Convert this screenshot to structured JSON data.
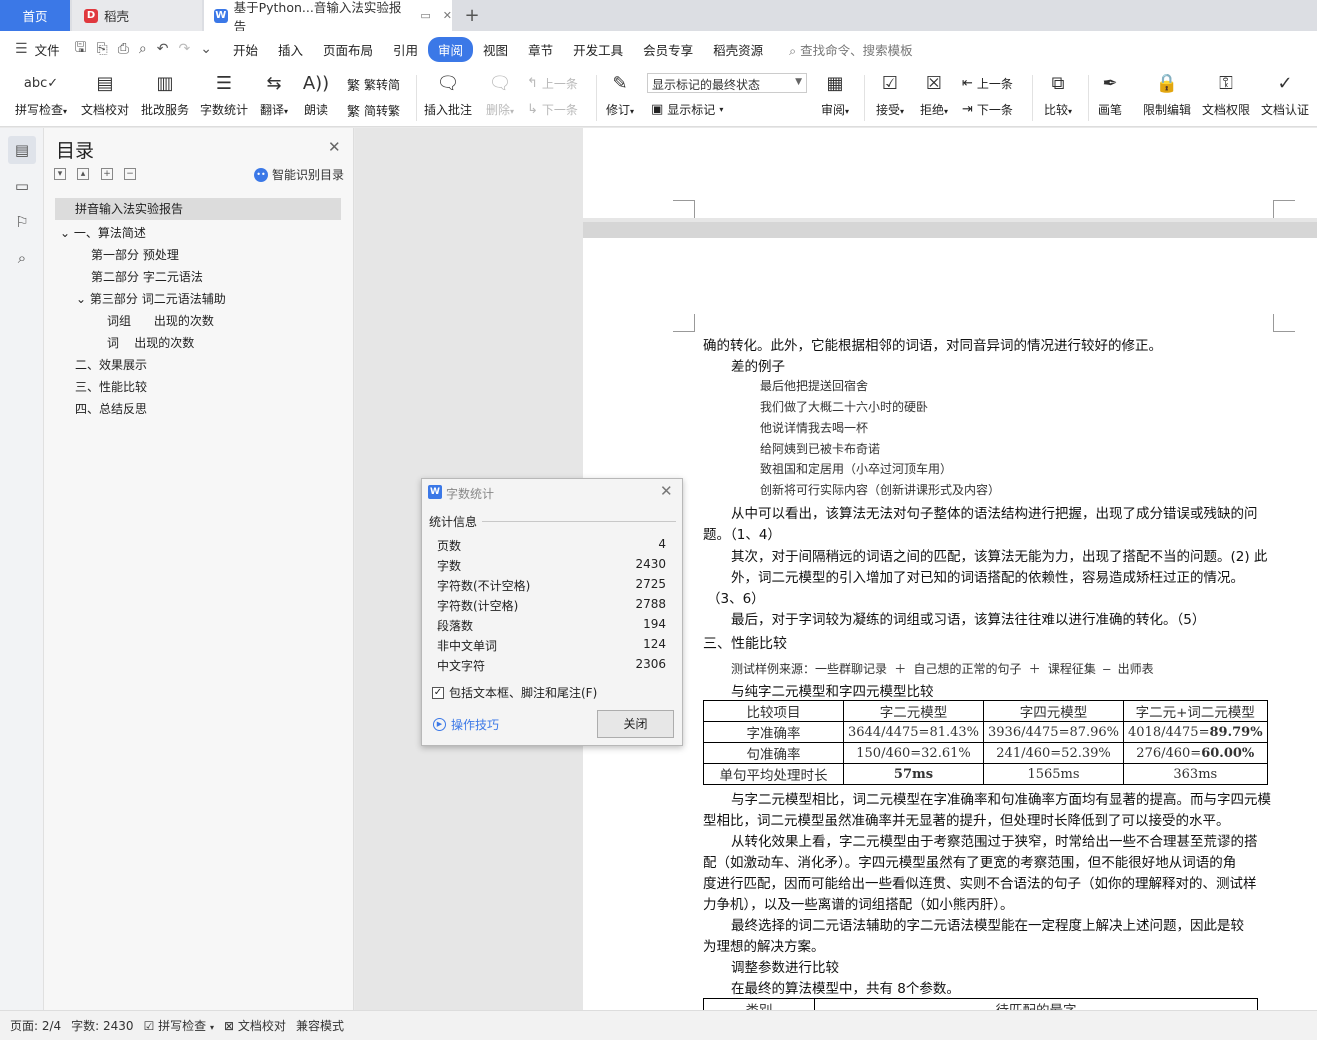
{
  "tabs": {
    "home": "首页",
    "daoke": "稻壳",
    "doc": "基于Python...音输入法实验报告",
    "plus": "+"
  },
  "menu": {
    "file": "文件",
    "items": [
      "开始",
      "插入",
      "页面布局",
      "引用",
      "审阅",
      "视图",
      "章节",
      "开发工具",
      "会员专享",
      "稻壳资源"
    ],
    "active": "审阅",
    "search": "查找命令、搜索模板"
  },
  "ribbon": {
    "spell": "拼写检查",
    "proofread": "文档校对",
    "review_service": "批改服务",
    "word_count": "字数统计",
    "translate": "翻译",
    "read_aloud": "朗读",
    "to_simplified": "繁转简",
    "to_traditional": "简转繁",
    "insert_comment": "插入批注",
    "delete": "删除",
    "prev": "上一条",
    "next": "下一条",
    "revise": "修订",
    "markup_state": "显示标记的最终状态",
    "show_markup": "显示标记",
    "review": "审阅",
    "accept": "接受",
    "reject": "拒绝",
    "prev2": "上一条",
    "next2": "下一条",
    "compare": "比较",
    "pen": "画笔",
    "restrict": "限制编辑",
    "permission": "文档权限",
    "certify": "文档认证"
  },
  "toc": {
    "title": "目录",
    "smart": "智能识别目录",
    "items": [
      "拼音输入法实验报告",
      "一、算法简述",
      "第一部分 预处理",
      "第二部分 字二元语法",
      "第三部分 词二元语法辅助",
      "词组      出现的次数",
      "词    出现的次数",
      "二、效果展示",
      "三、性能比较",
      "四、总结反思"
    ]
  },
  "doc": {
    "p1": "确的转化。此外，它能根据相邻的词语，对同音异词的情况进行较好的修正。",
    "bad_examples": "差的例子",
    "ex": [
      "最后他把提送回宿舍",
      "我们做了大概二十六小时的硬卧",
      "他说详情我去喝一杯",
      "给阿姨到已被卡布奇诺",
      "致祖国和定居用（小卒过河顶车用）",
      "创新将可行实际内容（创新讲课形式及内容）"
    ],
    "p2a": "从中可以看出，该算法无法对句子整体的语法结构进行把握，出现了成分错误或残缺的问",
    "p2b": "题。（1、4）",
    "p3a": "其次，对于间隔稍远的词语之间的匹配，该算法无能为力，出现了搭配不当的问题。(2)  此",
    "p3b": "外，词二元模型的引入增加了对已知的词语搭配的依赖性，容易造成矫枉过正的情况。",
    "p3c": "（3、6）",
    "p4": "最后，对于字词较为凝练的词组或习语，该算法往往难以进行准确的转化。（5）",
    "h3": "三、性能比较",
    "src": "测试样例来源：一些群聊记录 ＋ 自己想的正常的句子 ＋ 课程征集 ― 出师表",
    "cmp_title": "与纯字二元模型和字四元模型比较",
    "table": {
      "header": [
        "比较项目",
        "字二元模型",
        "字四元模型",
        "字二元+词二元模型"
      ],
      "rows": [
        [
          "字准确率",
          "3644/4475=81.43%",
          "3936/4475=87.96%",
          "4018/4475=",
          "89.79%"
        ],
        [
          "句准确率",
          "150/460=32.61%",
          "241/460=52.39%",
          "276/460=",
          "60.00%"
        ],
        [
          "单句平均处理时长",
          "57ms",
          "1565ms",
          "363ms",
          ""
        ]
      ]
    },
    "p5a": "与字二元模型相比，词二元模型在字准确率和句准确率方面均有显著的提高。而与字四元模",
    "p5b": "型相比，词二元模型虽然准确率并无显著的提升，但处理时长降低到了可以接受的水平。",
    "p6a": "从转化效果上看，字二元模型由于考察范围过于狭窄，时常给出一些不合理甚至荒谬的搭",
    "p6b": "配（如激动车、消化矛）。字四元模型虽然有了更宽的考察范围，但不能很好地从词语的角",
    "p6c": "度进行匹配，因而可能给出一些看似连贯、实则不合语法的句子（如你的理解释对的、测试样",
    "p6d": "力争机），以及一些离谱的词组搭配（如小熊丙肝）。",
    "p7a": "最终选择的词二元语法辅助的字二元语法模型能在一定程度上解决上述问题，因此是较",
    "p7b": "为理想的解决方案。",
    "adjust": "调整参数进行比较",
    "p8": "在最终的算法模型中，共有 8个参数。",
    "param_header": [
      "类别",
      "待匹配的最字"
    ]
  },
  "dialog": {
    "title": "字数统计",
    "section": "统计信息",
    "stats": [
      {
        "label": "页数",
        "value": "4"
      },
      {
        "label": "字数",
        "value": "2430"
      },
      {
        "label": "字符数(不计空格)",
        "value": "2725"
      },
      {
        "label": "字符数(计空格)",
        "value": "2788"
      },
      {
        "label": "段落数",
        "value": "194"
      },
      {
        "label": "非中文单词",
        "value": "124"
      },
      {
        "label": "中文字符",
        "value": "2306"
      }
    ],
    "include": "包括文本框、脚注和尾注(F)",
    "include_checked": true,
    "tips": "操作技巧",
    "close": "关闭"
  },
  "status": {
    "page": "页面: 2/4",
    "words": "字数: 2430",
    "spell": "拼写检查",
    "proofread": "文档校对",
    "compat": "兼容模式"
  },
  "colors": {
    "accent": "#3b78e7",
    "daoke_logo": "#e0383e"
  }
}
